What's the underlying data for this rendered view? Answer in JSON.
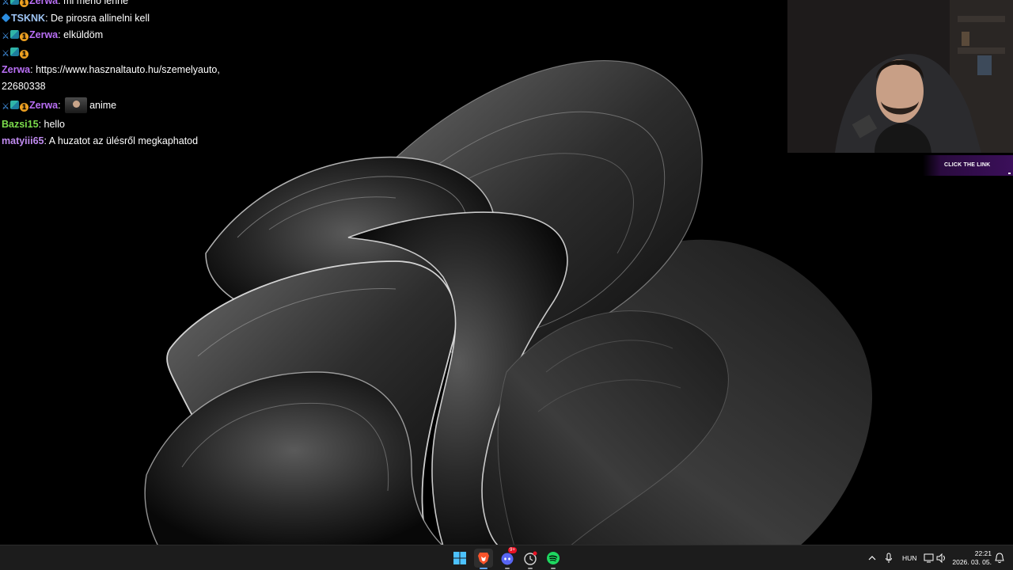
{
  "chat": {
    "messages": [
      {
        "badges": [
          "sword",
          "grid",
          "num"
        ],
        "user": "Zerwa",
        "color": "#b96ff5",
        "text": ": mi menő lenne"
      },
      {
        "badges": [
          "cube"
        ],
        "user": "TSKNK",
        "color": "#9fc5f5",
        "text": ": De pirosra allinelni kell"
      },
      {
        "badges": [
          "sword",
          "grid",
          "num"
        ],
        "user": "Zerwa",
        "color": "#b96ff5",
        "text": ": elküldöm"
      },
      {
        "badges": [
          "sword",
          "grid",
          "num"
        ],
        "user": "",
        "color": "#b96ff5",
        "text": ""
      },
      {
        "badges": [],
        "user": "Zerwa",
        "color": "#b96ff5",
        "text": ": https://www.hasznaltauto.hu/szemelyauto,"
      },
      {
        "badges": [],
        "user": "",
        "color": "#ffffff",
        "text": "22680338"
      },
      {
        "badges": [
          "sword",
          "grid",
          "num"
        ],
        "user": "Zerwa",
        "color": "#b96ff5",
        "text": ": ",
        "emote": true,
        "after": "anime"
      },
      {
        "badges": [],
        "user": "Bazsi15",
        "color": "#7cdc4c",
        "text": ": hello"
      },
      {
        "badges": [],
        "user": "matyiii65",
        "color": "#c08bf0",
        "text": ": A huzatot az ülésről megkaphatod"
      }
    ],
    "badge_number": "1"
  },
  "overlay": {
    "cta_label": "CLICK THE LINK"
  },
  "taskbar": {
    "apps": [
      {
        "name": "windows-start",
        "icon": "windows-logo-icon"
      },
      {
        "name": "brave",
        "icon": "brave-lion-icon"
      },
      {
        "name": "discord",
        "icon": "discord-icon",
        "badge": "9+"
      },
      {
        "name": "clock-app",
        "icon": "clock-icon"
      },
      {
        "name": "spotify",
        "icon": "spotify-icon"
      }
    ],
    "language": "HUN",
    "time": "22:21",
    "date": "2026. 03. 05."
  },
  "colors": {
    "taskbar_bg": "#1c1c1c",
    "accent": "#5ea4ff",
    "spotify": "#1ed760",
    "discord": "#5865f2",
    "brave": "#fb542b"
  }
}
